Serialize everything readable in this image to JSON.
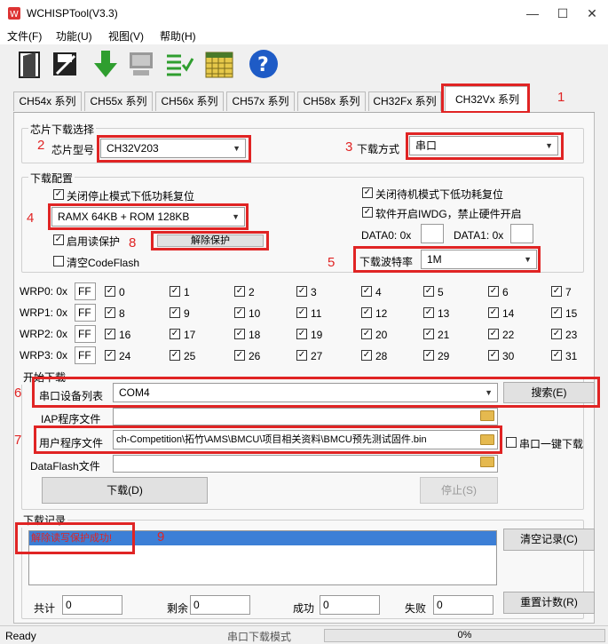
{
  "window": {
    "title": "WCHISPTool(V3.3)",
    "min": "—",
    "max": "☐",
    "close": "✕"
  },
  "menu": [
    "文件(F)",
    "功能(U)",
    "视图(V)",
    "帮助(H)"
  ],
  "toolbar": [
    "open-icon",
    "save-icon",
    "download-icon",
    "debug-icon",
    "list-icon",
    "calendar-icon",
    "help-icon"
  ],
  "tabs": [
    "CH54x 系列",
    "CH55x 系列",
    "CH56x 系列",
    "CH57x 系列",
    "CH58x 系列",
    "CH32Fx 系列",
    "CH32Vx 系列"
  ],
  "chip": {
    "group_label": "芯片下载选择",
    "model_label": "芯片型号",
    "model_value": "CH32V203",
    "mode_label": "下载方式",
    "mode_value": "串口"
  },
  "config": {
    "group_label": "下载配置",
    "chk_stop_reset": "关闭停止模式下低功耗复位",
    "mem_value": "RAMX 64KB + ROM 128KB",
    "chk_read_protect": "启用读保护",
    "unprotect_button": "解除保护",
    "chk_clear_codeflash": "清空CodeFlash",
    "chk_standby_reset": "关闭待机模式下低功耗复位",
    "chk_iwdg": "软件开启IWDG，禁止硬件开启",
    "data0_label": "DATA0: 0x",
    "data1_label": "DATA1: 0x",
    "baud_label": "下载波特率",
    "baud_value": "1M"
  },
  "wrp": {
    "rows": [
      {
        "label": "WRP0: 0x",
        "value": "FF",
        "bits": [
          "0",
          "1",
          "2",
          "3",
          "4",
          "5",
          "6",
          "7"
        ]
      },
      {
        "label": "WRP1: 0x",
        "value": "FF",
        "bits": [
          "8",
          "9",
          "10",
          "11",
          "12",
          "13",
          "14",
          "15"
        ]
      },
      {
        "label": "WRP2: 0x",
        "value": "FF",
        "bits": [
          "16",
          "17",
          "18",
          "19",
          "20",
          "21",
          "22",
          "23"
        ]
      },
      {
        "label": "WRP3: 0x",
        "value": "FF",
        "bits": [
          "24",
          "25",
          "26",
          "27",
          "28",
          "29",
          "30",
          "31"
        ]
      }
    ]
  },
  "start": {
    "group_label": "开始下载",
    "port_label": "串口设备列表",
    "port_value": "COM4",
    "search_button": "搜索(E)",
    "iap_label": "IAP程序文件",
    "user_label": "用户程序文件",
    "user_path": "ch-Competition\\拓竹\\AMS\\BMCU\\项目相关资料\\BMCU预先测试固件.bin",
    "oneclick_label": "串口一键下载",
    "dataflash_label": "DataFlash文件",
    "download_button": "下载(D)",
    "stop_button": "停止(S)"
  },
  "log": {
    "group_label": "下载记录",
    "message": "解除读写保护成功!",
    "clear_button": "清空记录(C)",
    "reset_button": "重置计数(R)",
    "total_label": "共计",
    "total_value": "0",
    "remain_label": "剩余",
    "remain_value": "0",
    "success_label": "成功",
    "success_value": "0",
    "fail_label": "失败",
    "fail_value": "0"
  },
  "annotations": [
    "1",
    "2",
    "3",
    "4",
    "5",
    "6",
    "7",
    "8",
    "9"
  ],
  "status": {
    "left": "Ready",
    "mode": "串口下载模式",
    "progress": "0%"
  },
  "colors": {
    "annotation": "#e02424",
    "selection": "#3c7fd6",
    "help": "#1e5bc6",
    "arrow": "#2f9e2f"
  }
}
